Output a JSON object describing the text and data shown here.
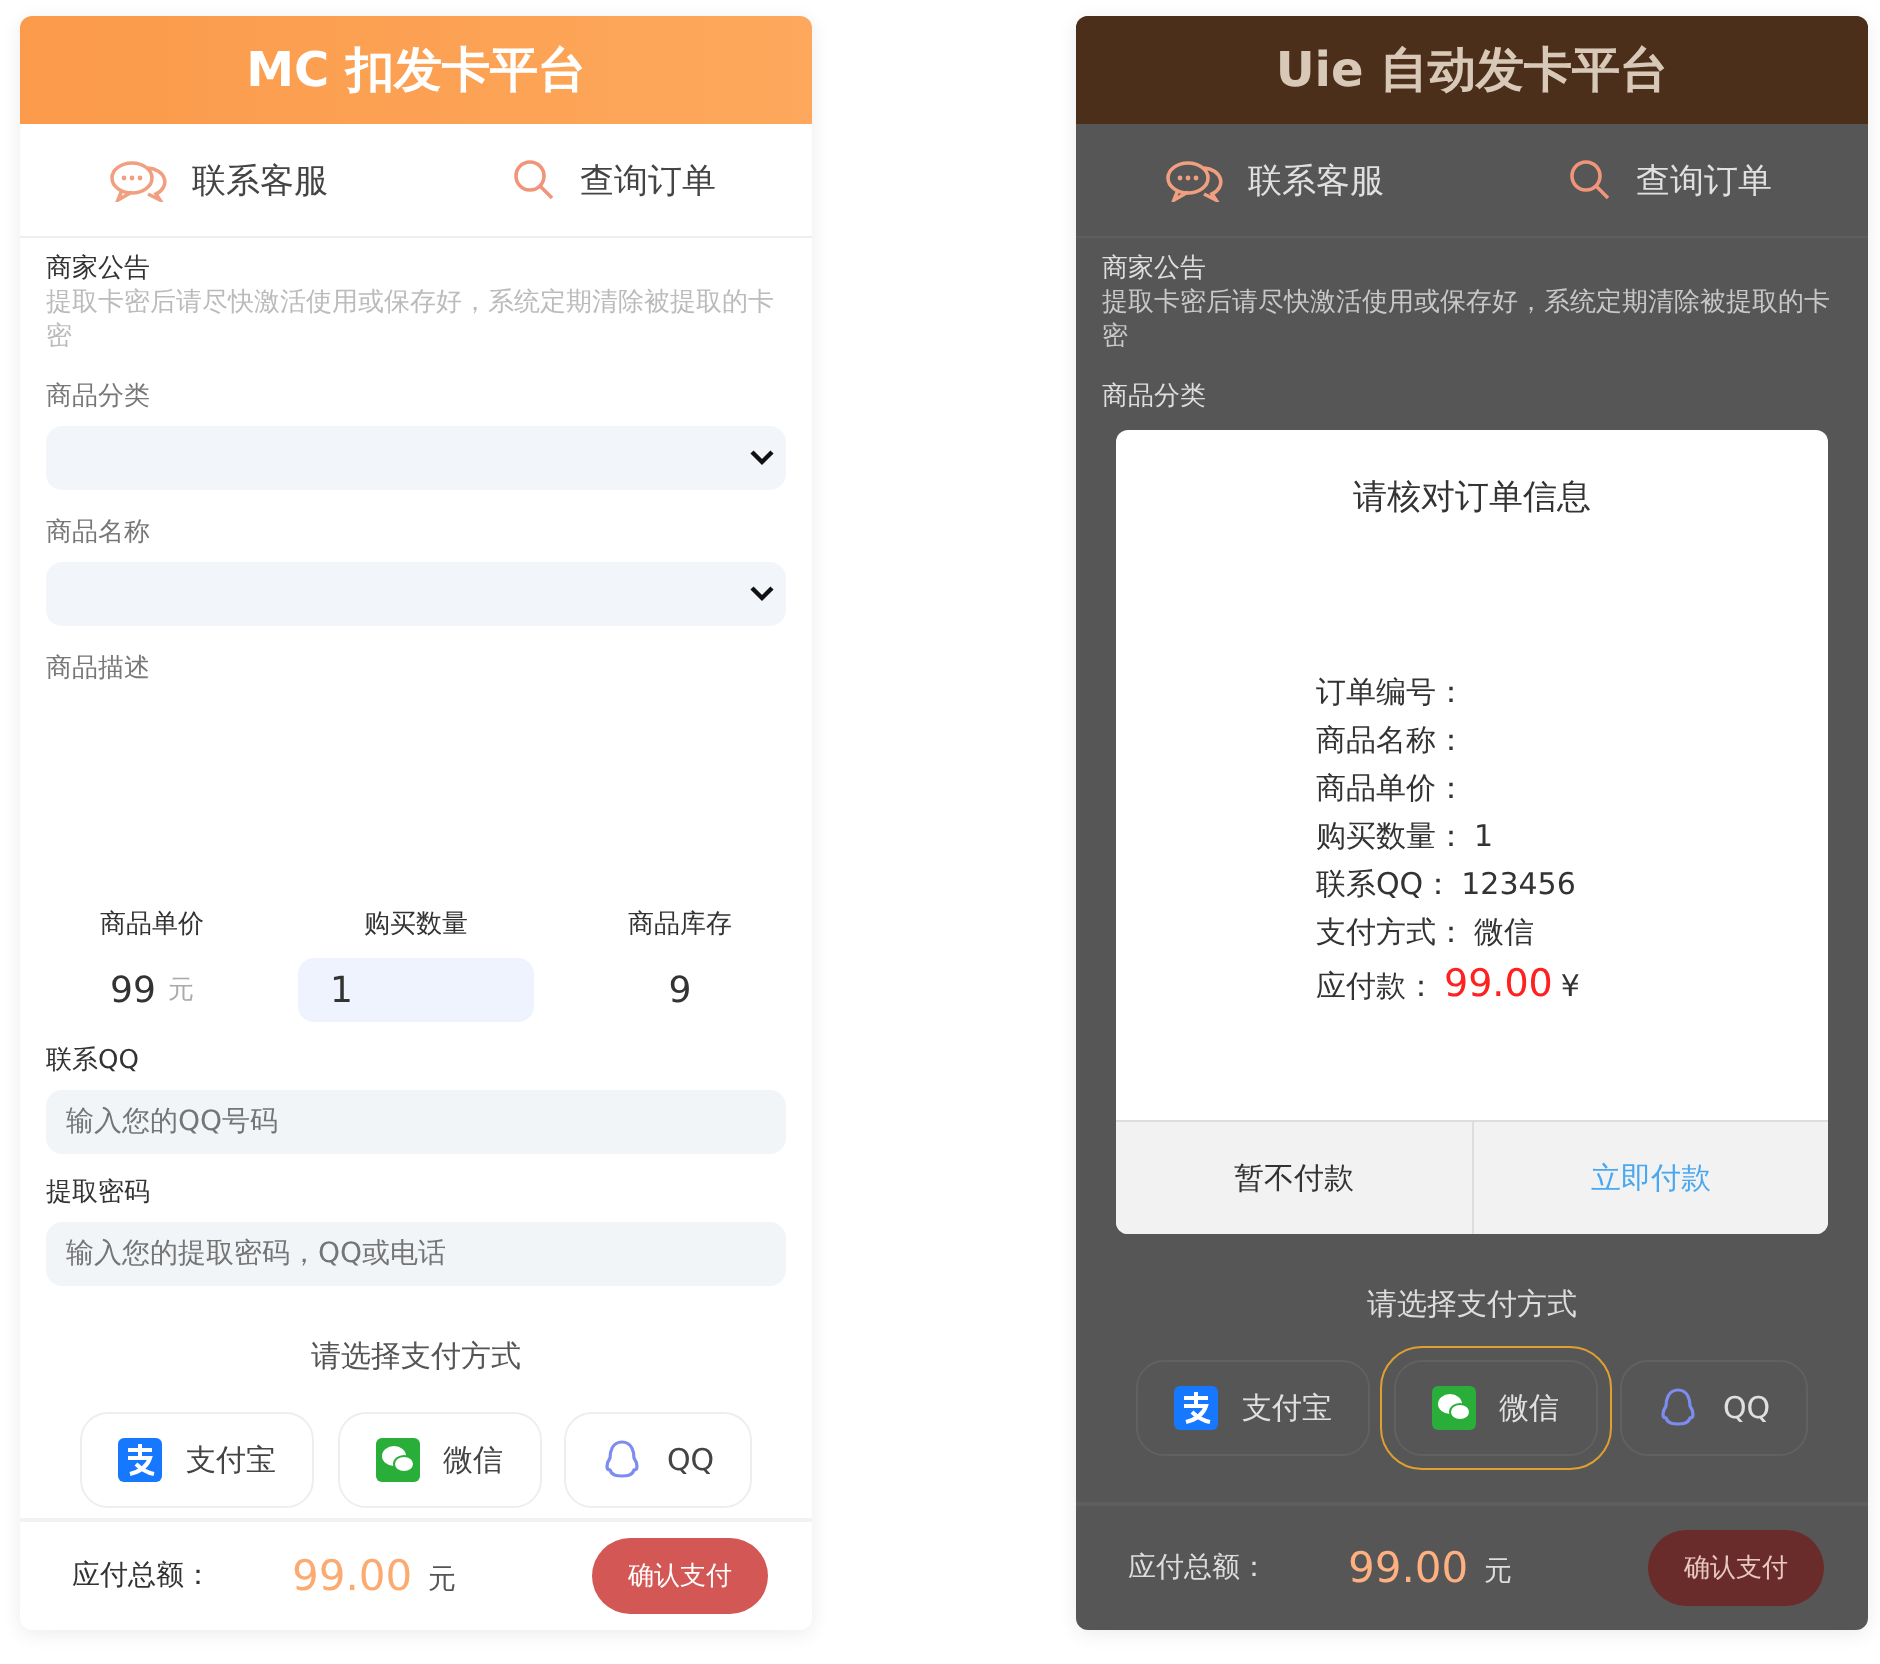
{
  "screens": [
    {
      "header": {
        "title": "MC 扣发卡平台"
      },
      "tabs": [
        {
          "label": "联系客服"
        },
        {
          "label": "查询订单"
        }
      ],
      "notice": {
        "title": "商家公告",
        "text": "提取卡密后请尽快激活使用或保存好，系统定期清除被提取的卡密"
      },
      "fields": [
        {
          "label": "商品分类",
          "kind": "select"
        },
        {
          "label": "商品名称",
          "kind": "select"
        },
        {
          "label": "商品描述",
          "kind": "text"
        }
      ],
      "stats": [
        {
          "label": "商品单价",
          "value": "99",
          "unit": "元",
          "kind": "text"
        },
        {
          "label": "购买数量",
          "value": "1",
          "kind": "input"
        },
        {
          "label": "商品库存",
          "value": "9",
          "kind": "text"
        }
      ],
      "contacts": [
        {
          "label": "联系QQ",
          "placeholder": "输入您的QQ号码"
        },
        {
          "label": "提取密码",
          "placeholder": "输入您的提取密码，QQ或电话"
        }
      ],
      "pay_prompt": "请选择支付方式",
      "pay_methods": [
        {
          "label": "支付宝",
          "selected": false
        },
        {
          "label": "微信",
          "selected": false
        },
        {
          "label": "QQ",
          "selected": false
        }
      ],
      "footer": {
        "label": "应付总额：",
        "amount": "99.00",
        "unit": "元",
        "button": "确认支付"
      }
    },
    {
      "header": {
        "title": "Uie 自动发卡平台"
      },
      "tabs": [
        {
          "label": "联系客服"
        },
        {
          "label": "查询订单"
        }
      ],
      "notice": {
        "title": "商家公告",
        "text": "提取卡密后请尽快激活使用或保存好，系统定期清除被提取的卡密"
      },
      "fields": [
        {
          "label": "商品分类",
          "kind": "none"
        }
      ],
      "modal": {
        "title": "请核对订单信息",
        "rows": [
          {
            "label": "订单编号：",
            "kind": "plain"
          },
          {
            "label": "商品名称：",
            "kind": "plain"
          },
          {
            "label": "商品单价：",
            "kind": "plain"
          },
          {
            "label": "购买数量：",
            "value": "1",
            "kind": "plain"
          },
          {
            "label": "联系QQ：",
            "value": "123456",
            "kind": "plain"
          },
          {
            "label": "支付方式：",
            "value": "微信",
            "kind": "plain"
          },
          {
            "label": "应付款：",
            "value": "99.00",
            "unit": "¥",
            "kind": "amount"
          }
        ],
        "buttons": [
          {
            "label": "暂不付款",
            "kind": "secondary"
          },
          {
            "label": "立即付款",
            "kind": "primary"
          }
        ]
      },
      "pay_prompt": "请选择支付方式",
      "pay_methods": [
        {
          "label": "支付宝",
          "selected": false
        },
        {
          "label": "微信",
          "selected": true
        },
        {
          "label": "QQ",
          "selected": false
        }
      ],
      "footer": {
        "label": "应付总额：",
        "amount": "99.00",
        "unit": "元",
        "button": "确认支付"
      }
    }
  ]
}
